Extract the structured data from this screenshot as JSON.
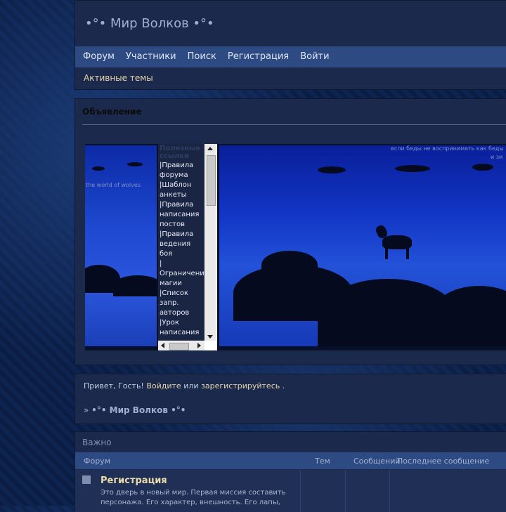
{
  "header": {
    "board_title": "•°• Мир Волков •°•"
  },
  "nav": {
    "items": [
      {
        "label": "Форум"
      },
      {
        "label": "Участники"
      },
      {
        "label": "Поиск"
      },
      {
        "label": "Регистрация"
      },
      {
        "label": "Войти"
      }
    ]
  },
  "subnav": {
    "active_topics": "Активные темы"
  },
  "announcement": {
    "title": "Объявление",
    "banner_left_caption": "the world of wolves",
    "banner_right_caption_1": "если беды не воспринимать как беды",
    "banner_right_caption_2": "и зи",
    "links_heading": "Полезные ссылки",
    "links": [
      "|Правила",
      "форума",
      "|Шаблон",
      "анкеты",
      "|Правила",
      "написания",
      "постов",
      "|Правила",
      "ведения",
      "боя",
      "|",
      "Ограничени",
      "магии",
      "|Список",
      "запр.",
      "авторов",
      "|Урок",
      "написания"
    ]
  },
  "greeting": {
    "prefix": "Привет, Гость! ",
    "login": "Войдите",
    "middle": " или ",
    "register": "зарегистрируйтесь",
    "suffix": "."
  },
  "breadcrumb": {
    "arrow": "» ",
    "board": "•°• Мир Волков •°•"
  },
  "category": {
    "title": "Важно",
    "columns": {
      "forum": "Форум",
      "topics": "Тем",
      "posts": "Сообщений",
      "last_post": "Последнее сообщение"
    },
    "forums": [
      {
        "name": "Регистрация",
        "description": "Это дверь в новый мир. Первая миссия составить персонажа. Его характер, внешность. Его лапы,"
      }
    ]
  },
  "colors": {
    "navbar": "#2e4a82",
    "panel": "#1b2a4c",
    "link_accent": "#e6d6a8"
  }
}
